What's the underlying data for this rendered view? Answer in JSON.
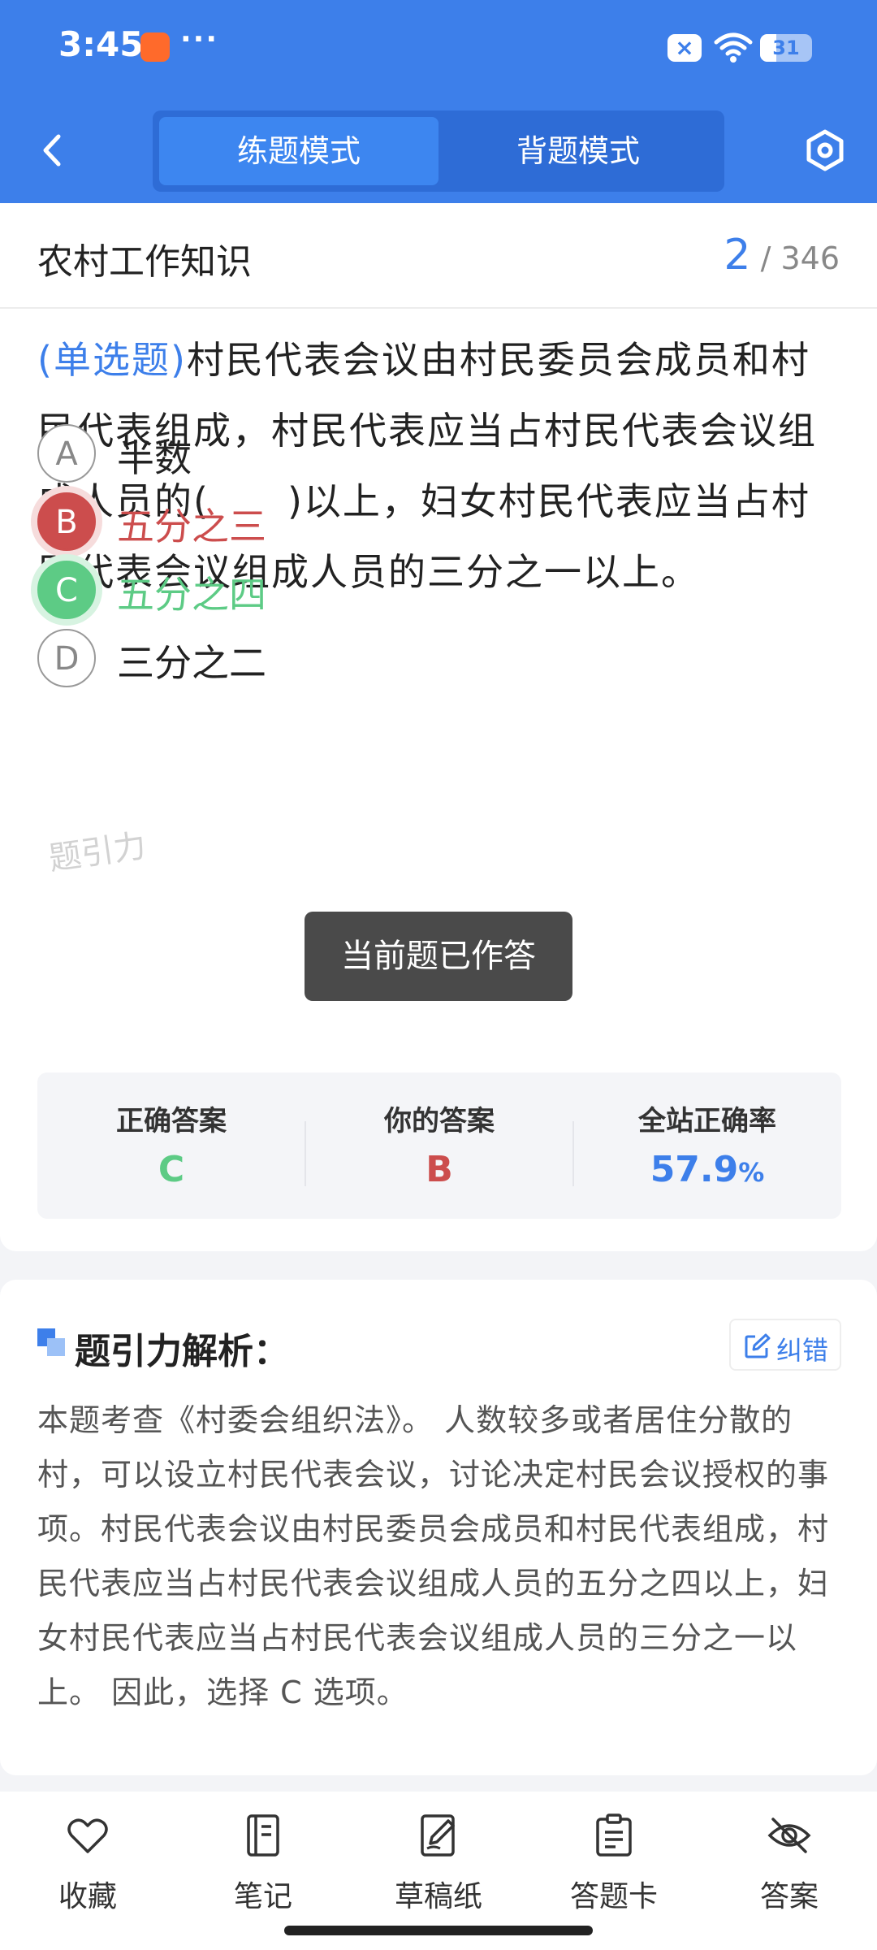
{
  "status_bar": {
    "time": "3:45",
    "more": "···",
    "battery": "31"
  },
  "header": {
    "tabs": [
      {
        "label": "练题模式",
        "active": true
      },
      {
        "label": "背题模式",
        "active": false
      }
    ]
  },
  "subject": {
    "title": "农村工作知识",
    "current": "2",
    "total": "/ 346"
  },
  "question": {
    "type": "(单选题)",
    "text": "村民代表会议由村民委员会成员和村民代表组成，村民代表应当占村民代表会议组成人员的(　　)以上，妇女村民代表应当占村民代表会议组成人员的三分之一以上。"
  },
  "options": [
    {
      "key": "A",
      "text": "半数",
      "state": "normal"
    },
    {
      "key": "B",
      "text": "五分之三",
      "state": "wrong"
    },
    {
      "key": "C",
      "text": "五分之四",
      "state": "correct"
    },
    {
      "key": "D",
      "text": "三分之二",
      "state": "normal"
    }
  ],
  "watermark": "题引力",
  "toast": "当前题已作答",
  "answer_stats": {
    "correct_label": "正确答案",
    "correct_value": "C",
    "yours_label": "你的答案",
    "yours_value": "B",
    "rate_label": "全站正确率",
    "rate_value": "57.9",
    "rate_unit": "%"
  },
  "analysis": {
    "title": "题引力解析：",
    "report_label": "纠错",
    "body": "本题考查《村委会组织法》。 人数较多或者居住分散的村，可以设立村民代表会议，讨论决定村民会议授权的事项。村民代表会议由村民委员会成员和村民代表组成，村民代表应当占村民代表会议组成人员的五分之四以上，妇女村民代表应当占村民代表会议组成人员的三分之一以上。 因此，选择 C 选项。"
  },
  "bottom_bar": {
    "items": [
      {
        "label": "收藏",
        "icon": "heart-icon"
      },
      {
        "label": "笔记",
        "icon": "notebook-icon"
      },
      {
        "label": "草稿纸",
        "icon": "draft-paper-icon"
      },
      {
        "label": "答题卡",
        "icon": "answer-sheet-icon"
      },
      {
        "label": "答案",
        "icon": "eye-off-icon"
      }
    ]
  },
  "colors": {
    "brand": "#3d7fea",
    "correct": "#5dcb85",
    "wrong": "#cc4d4d"
  }
}
